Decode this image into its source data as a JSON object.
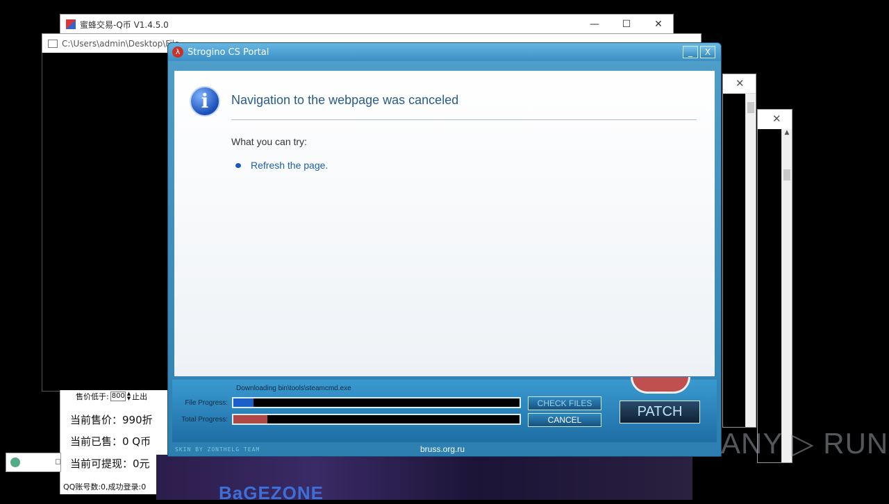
{
  "bg_window1": {
    "title": "蜜蜂交易-Q币 V1.4.5.0"
  },
  "bg_window2": {
    "title": "C:\\Users\\admin\\Desktop\\File"
  },
  "bg_panel": {
    "price_low_label": "售价低于:",
    "price_low_value": "800",
    "stop_label": "止出",
    "current_price": "当前售价：990折",
    "sold": "当前已售：0 Q币",
    "withdraw": "当前可提现：0元",
    "status": "QQ账号数:0,成功登录:0"
  },
  "portal": {
    "title": "Strogino CS Portal",
    "minimize_label": "_",
    "close_label": "X",
    "nav_title": "Navigation to the webpage was canceled",
    "try_label": "What you can try:",
    "refresh_link": "Refresh the page.",
    "downloading": "Downloading bin\\tools\\steamcmd.exe",
    "file_progress_label": "File Progress:",
    "file_progress": 0.07,
    "total_progress_label": "Total Progress:",
    "total_progress": 0.12,
    "check_files": "CHECK FILES",
    "cancel": "CANCEL",
    "patch": "PATCH",
    "skin_credit": "SKIN BY ZONTHELG TEAM",
    "site": "bruss.org.ru"
  },
  "game_banner": {
    "text": "BaGEZONE"
  },
  "watermark": {
    "text": "ANY ▷ RUN"
  },
  "colors": {
    "file_fill": "#1b5fc8",
    "total_fill": "#b04848"
  }
}
